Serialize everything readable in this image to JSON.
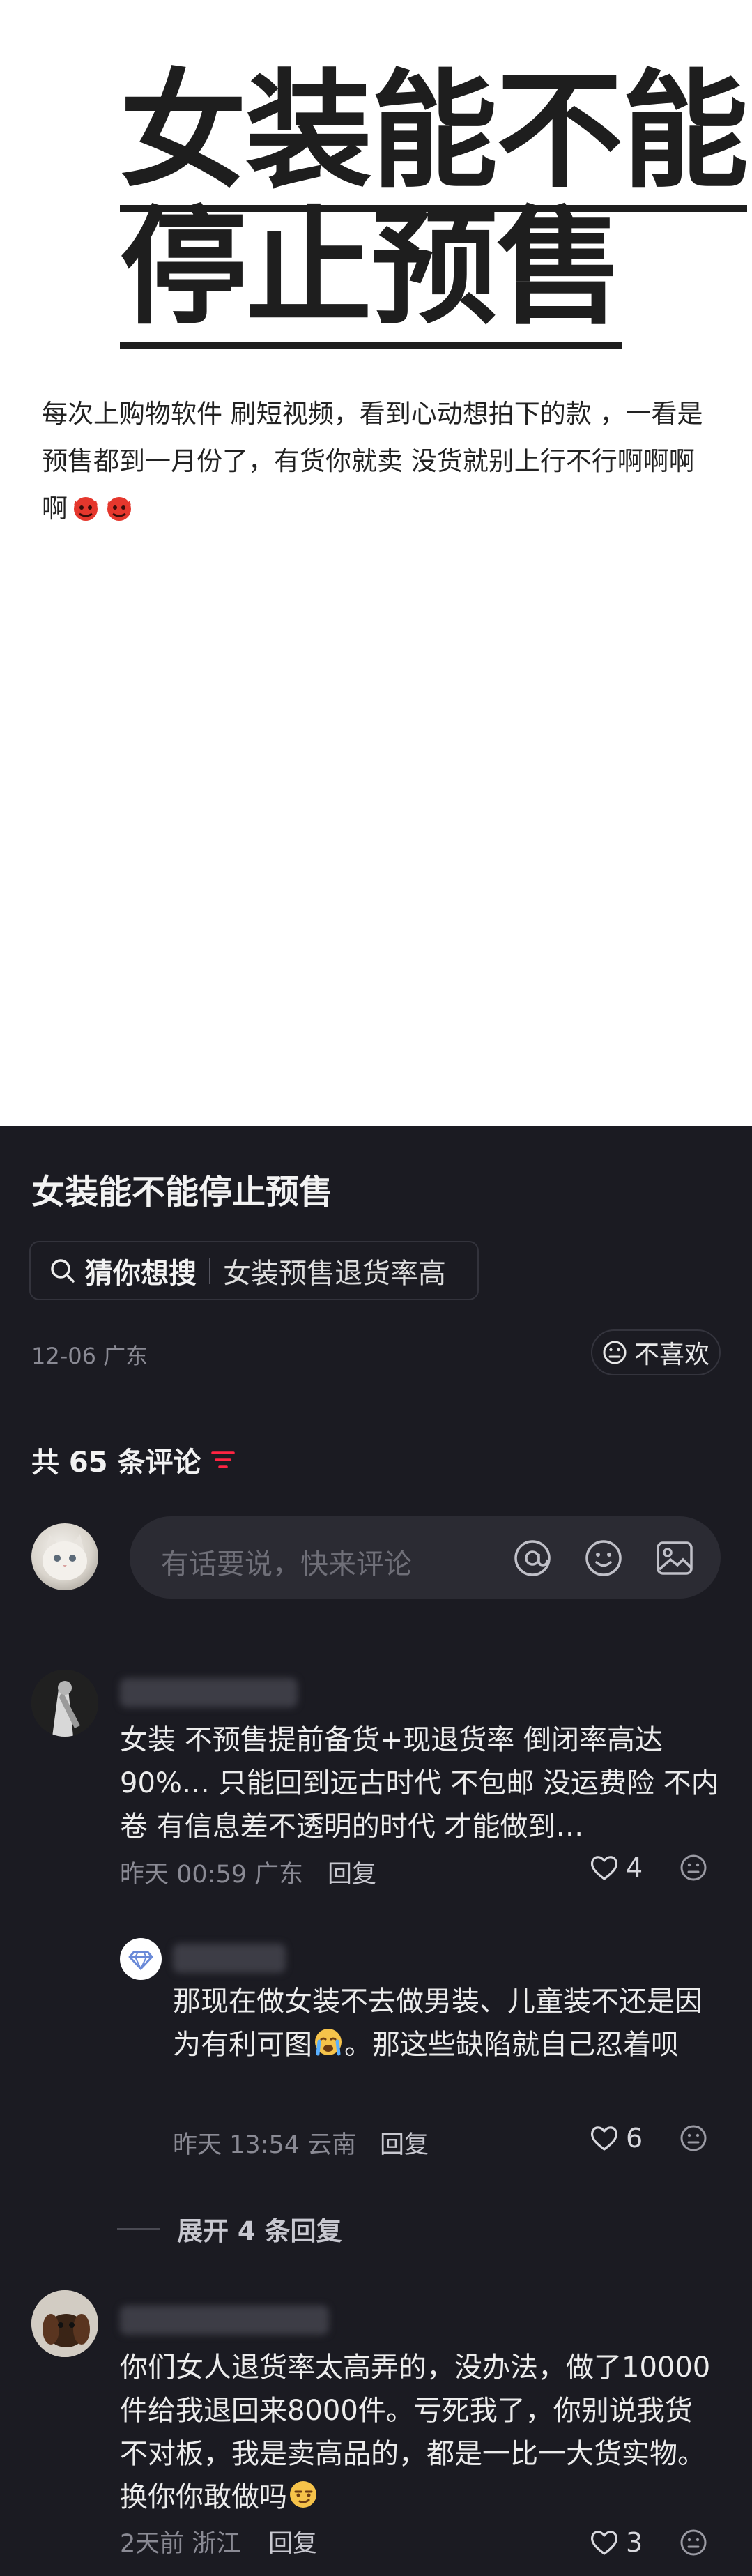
{
  "note": {
    "cover_title_line1": "女装能不能",
    "cover_title_line2": "停止预售",
    "body": "每次上购物软件 刷短视频，看到心动想拍下的款 ，一看是预售都到一月份了，有货你就卖 没货就别上行不行啊啊啊啊",
    "body_emojis": [
      "devil-face-emoji",
      "devil-face-emoji"
    ]
  },
  "sheet": {
    "title": "女装能不能停止预售",
    "search_chip": {
      "bold": "猜你想搜",
      "query": "女装预售退货率高"
    },
    "meta": "12-06 广东",
    "dislike_label": "不喜欢",
    "comment_count": "共 65 条评论",
    "input_placeholder": "有话要说，快来评论",
    "input_icons": [
      "at-icon",
      "emoji-icon",
      "image-icon"
    ]
  },
  "comments": [
    {
      "text": "女装 不预售提前备货+现退货率 倒闭率高达90%… 只能回到远古时代 不包邮 没运费险 不内卷 有信息差不透明的时代 才能做到…",
      "meta": "昨天 00:59 广东",
      "reply_label": "回复",
      "likes": "4"
    },
    {
      "text": "那现在做女装不去做男装、儿童装不还是因为有利可图",
      "text_tail": "。那这些缺陷就自己忍着呗",
      "meta": "昨天 13:54 云南",
      "reply_label": "回复",
      "likes": "6"
    },
    {
      "text": "你们女人退货率太高弄的，没办法，做了10000件给我退回来8000件。亏死我了，你别说我货不对板，我是卖高品的，都是一比一大货实物。换你你敢做吗",
      "meta": "2天前 浙江",
      "reply_label": "回复",
      "likes": "3"
    }
  ],
  "expand_replies": "展开 4 条回复",
  "colors": {
    "sheet_bg": "#1b1b22",
    "accent_red": "#ff2442",
    "text_muted": "#8a8a94"
  }
}
